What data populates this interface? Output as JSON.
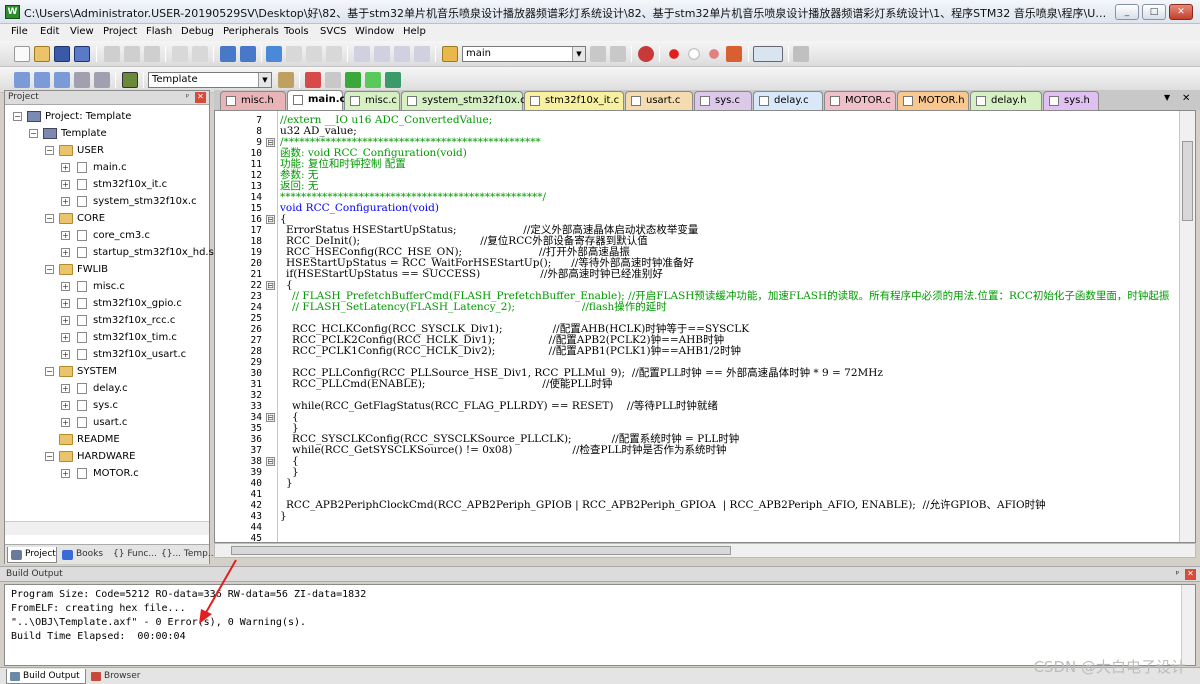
{
  "window": {
    "title": "C:\\Users\\Administrator.USER-20190529SV\\Desktop\\好\\82、基于stm32单片机音乐喷泉设计播放器频谱彩灯系统设计\\82、基于stm32单片机音乐喷泉设计播放器频谱彩灯系统设计\\1、程序STM32 音乐喷泉\\程序\\USER\\Template.uvpr...",
    "app_icon": "W",
    "minimize": "_",
    "maximize": "□",
    "close": "✕"
  },
  "menu": [
    "File",
    "Edit",
    "View",
    "Project",
    "Flash",
    "Debug",
    "Peripherals",
    "Tools",
    "SVCS",
    "Window",
    "Help"
  ],
  "toolbar": {
    "find_value": "main",
    "target_value": "Template"
  },
  "project_panel": {
    "title": "Project",
    "pin": "ᵖ",
    "close": "✕",
    "root": "Project: Template",
    "target": "Template",
    "groups": [
      {
        "name": "USER",
        "files": [
          "main.c",
          "stm32f10x_it.c",
          "system_stm32f10x.c"
        ]
      },
      {
        "name": "CORE",
        "files": [
          "core_cm3.c",
          "startup_stm32f10x_hd.s"
        ]
      },
      {
        "name": "FWLIB",
        "files": [
          "misc.c",
          "stm32f10x_gpio.c",
          "stm32f10x_rcc.c",
          "stm32f10x_tim.c",
          "stm32f10x_usart.c"
        ]
      },
      {
        "name": "SYSTEM",
        "files": [
          "delay.c",
          "sys.c",
          "usart.c"
        ]
      },
      {
        "name": "README",
        "files": []
      },
      {
        "name": "HARDWARE",
        "files": [
          "MOTOR.c"
        ]
      }
    ],
    "tabs": [
      "Project",
      "Books",
      "{} Func...",
      "{}... Temp..."
    ]
  },
  "file_tabs": [
    {
      "label": "misc.h",
      "color": "#e8b4b8"
    },
    {
      "label": "main.c",
      "color": "#ffffff",
      "active": true
    },
    {
      "label": "misc.c",
      "color": "#d6f0c4"
    },
    {
      "label": "system_stm32f10x.c",
      "color": "#d6f0c4"
    },
    {
      "label": "stm32f10x_it.c",
      "color": "#f6f0a0"
    },
    {
      "label": "usart.c",
      "color": "#f4dcb0"
    },
    {
      "label": "sys.c",
      "color": "#dcc8e8"
    },
    {
      "label": "delay.c",
      "color": "#d8e8f8"
    },
    {
      "label": "MOTOR.c",
      "color": "#f0c0c8"
    },
    {
      "label": "MOTOR.h",
      "color": "#f8c890"
    },
    {
      "label": "delay.h",
      "color": "#d6f0c4"
    },
    {
      "label": "sys.h",
      "color": "#e0c0f0"
    }
  ],
  "tabstrip_menu": "▼",
  "tabstrip_close": "✕",
  "code_lines": [
    {
      "n": "7",
      "t": "//extern __IO u16 ADC_ConvertedValue;",
      "c": "cm",
      "i": 0
    },
    {
      "n": "8",
      "t": "u32 AD_value;",
      "c": "",
      "i": 0
    },
    {
      "n": "9",
      "t": "/*************************************************",
      "c": "cm",
      "i": 0,
      "f": "⊟"
    },
    {
      "n": "10",
      "t": "函数: void RCC_Configuration(void)",
      "c": "cm",
      "i": 0
    },
    {
      "n": "11",
      "t": "功能: 复位和时钟控制 配置",
      "c": "cm",
      "i": 0
    },
    {
      "n": "12",
      "t": "参数: 无",
      "c": "cm",
      "i": 0
    },
    {
      "n": "13",
      "t": "返回: 无",
      "c": "cm",
      "i": 0
    },
    {
      "n": "14",
      "t": "**************************************************/",
      "c": "cm",
      "i": 0
    },
    {
      "n": "15",
      "t": "void RCC_Configuration(void)",
      "c": "kw",
      "i": 0
    },
    {
      "n": "16",
      "t": "{",
      "c": "",
      "i": 0,
      "f": "⊟"
    },
    {
      "n": "17",
      "t": "ErrorStatus HSEStartUpStatus;                    //定义外部高速晶体启动状态枚举变量",
      "c": "",
      "i": 1
    },
    {
      "n": "18",
      "t": "RCC_DeInit();                                    //复位RCC外部设备寄存器到默认值",
      "c": "",
      "i": 1
    },
    {
      "n": "19",
      "t": "RCC_HSEConfig(RCC_HSE_ON);                       //打开外部高速晶振",
      "c": "",
      "i": 1
    },
    {
      "n": "20",
      "t": "HSEStartUpStatus = RCC_WaitForHSEStartUp();      //等待外部高速时钟准备好",
      "c": "",
      "i": 1
    },
    {
      "n": "21",
      "t": "if(HSEStartUpStatus == SUCCESS)                  //外部高速时钟已经准别好",
      "c": "",
      "i": 1
    },
    {
      "n": "22",
      "t": "{",
      "c": "",
      "i": 1,
      "f": "⊟"
    },
    {
      "n": "23",
      "t": "// FLASH_PrefetchBufferCmd(FLASH_PrefetchBuffer_Enable); //开启FLASH预读缓冲功能，加速FLASH的读取。所有程序中必须的用法.位置：RCC初始化子函数里面，时钟起振",
      "c": "cm",
      "i": 2
    },
    {
      "n": "24",
      "t": "// FLASH_SetLatency(FLASH_Latency_2);                    //flash操作的延时",
      "c": "cm",
      "i": 2
    },
    {
      "n": "25",
      "t": "",
      "c": "",
      "i": 0
    },
    {
      "n": "26",
      "t": "RCC_HCLKConfig(RCC_SYSCLK_Div1);               //配置AHB(HCLK)时钟等于==SYSCLK",
      "c": "",
      "i": 2
    },
    {
      "n": "27",
      "t": "RCC_PCLK2Config(RCC_HCLK_Div1);                //配置APB2(PCLK2)钟==AHB时钟",
      "c": "",
      "i": 2
    },
    {
      "n": "28",
      "t": "RCC_PCLK1Config(RCC_HCLK_Div2);                //配置APB1(PCLK1)钟==AHB1/2时钟",
      "c": "",
      "i": 2
    },
    {
      "n": "29",
      "t": "",
      "c": "",
      "i": 0
    },
    {
      "n": "30",
      "t": "RCC_PLLConfig(RCC_PLLSource_HSE_Div1, RCC_PLLMul_9);  //配置PLL时钟 == 外部高速晶体时钟 * 9 = 72MHz",
      "c": "",
      "i": 2
    },
    {
      "n": "31",
      "t": "RCC_PLLCmd(ENABLE);                                   //使能PLL时钟",
      "c": "",
      "i": 2
    },
    {
      "n": "32",
      "t": "",
      "c": "",
      "i": 0
    },
    {
      "n": "33",
      "t": "while(RCC_GetFlagStatus(RCC_FLAG_PLLRDY) == RESET)    //等待PLL时钟就绪",
      "c": "",
      "i": 2
    },
    {
      "n": "34",
      "t": "{",
      "c": "",
      "i": 2,
      "f": "⊟"
    },
    {
      "n": "35",
      "t": "}",
      "c": "",
      "i": 2
    },
    {
      "n": "36",
      "t": "RCC_SYSCLKConfig(RCC_SYSCLKSource_PLLCLK);            //配置系统时钟 = PLL时钟",
      "c": "",
      "i": 2
    },
    {
      "n": "37",
      "t": "while(RCC_GetSYSCLKSource() != 0x08)                  //检查PLL时钟是否作为系统时钟",
      "c": "",
      "i": 2
    },
    {
      "n": "38",
      "t": "{",
      "c": "",
      "i": 2,
      "f": "⊟"
    },
    {
      "n": "39",
      "t": "}",
      "c": "",
      "i": 2
    },
    {
      "n": "40",
      "t": "}",
      "c": "",
      "i": 1
    },
    {
      "n": "41",
      "t": "",
      "c": "",
      "i": 0
    },
    {
      "n": "42",
      "t": "RCC_APB2PeriphClockCmd(RCC_APB2Periph_GPIOB | RCC_APB2Periph_GPIOA  | RCC_APB2Periph_AFIO, ENABLE);  //允许GPIOB、AFIO时钟",
      "c": "",
      "i": 1
    },
    {
      "n": "43",
      "t": "}",
      "c": "",
      "i": 0
    },
    {
      "n": "44",
      "t": "",
      "c": "",
      "i": 0
    },
    {
      "n": "45",
      "t": "",
      "c": "",
      "i": 0
    }
  ],
  "build_output": {
    "title": "Build Output",
    "pin": "ᵖ",
    "close": "✕",
    "lines": [
      "Program Size: Code=5212 RO-data=336 RW-data=56 ZI-data=1832",
      "FromELF: creating hex file...",
      "\"..\\OBJ\\Template.axf\" - 0 Error(s), 0 Warning(s).",
      "Build Time Elapsed:  00:00:04"
    ]
  },
  "bottom_tabs": [
    "Build Output",
    "Browser"
  ],
  "watermark": "CSDN @大白电子设计",
  "colors": {
    "comment": "#009900",
    "keyword": "#0000ff",
    "annotation_arrow": "#e02020"
  }
}
